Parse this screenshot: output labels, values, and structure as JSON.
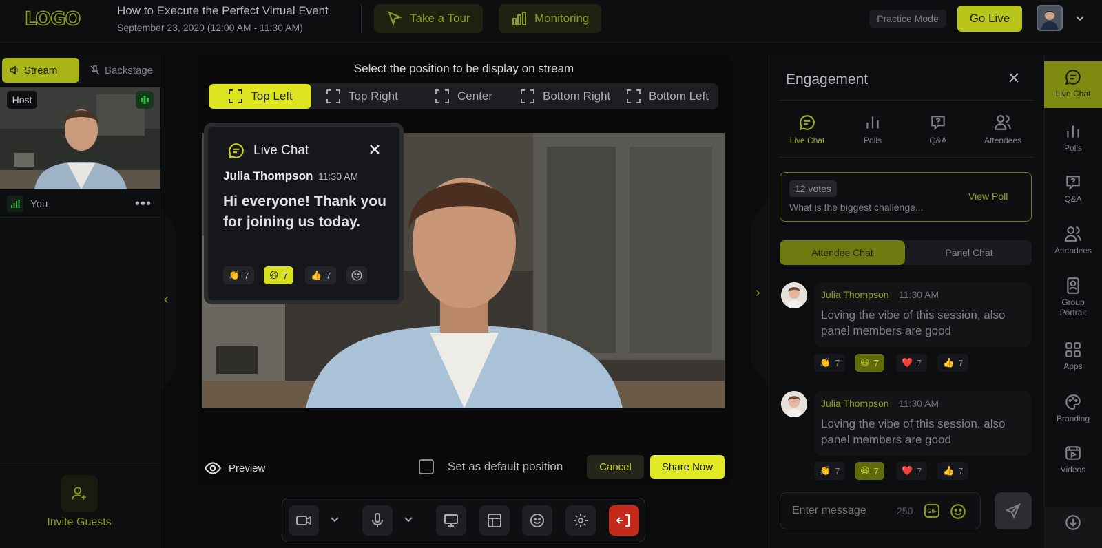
{
  "header": {
    "logo": "LOGO",
    "event_title": "How to Execute the Perfect Virtual Event",
    "event_date": "September 23, 2020 (12:00 AM - 11:30 AM)",
    "take_tour": "Take a Tour",
    "monitoring": "Monitoring",
    "practice_mode": "Practice Mode",
    "go_live": "Go Live"
  },
  "left": {
    "stream": "Stream",
    "backstage": "Backstage",
    "host_badge": "Host",
    "you_label": "You",
    "more": "•••",
    "invite_guests": "Invite Guests"
  },
  "modal": {
    "title": "Select the position to be display on stream",
    "positions": [
      "Top Left",
      "Top Right",
      "Center",
      "Bottom Right",
      "Bottom Left"
    ],
    "active_position": "Top Left",
    "preview": "Preview",
    "default_label": "Set as default position",
    "cancel": "Cancel",
    "share": "Share Now"
  },
  "overlay": {
    "title": "Live Chat",
    "name": "Julia Thompson",
    "time": "11:30 AM",
    "message": "Hi everyone! Thank you for joining us today.",
    "reactions": [
      {
        "emoji": "👏",
        "count": "7"
      },
      {
        "emoji": "😆",
        "count": "7"
      },
      {
        "emoji": "👍",
        "count": "7"
      }
    ]
  },
  "engagement": {
    "title": "Engagement",
    "tabs": [
      "Live Chat",
      "Polls",
      "Q&A",
      "Attendees"
    ],
    "poll_votes": "12 votes",
    "poll_question": "What is the biggest challenge...",
    "view_poll": "View Poll",
    "attendee_chat": "Attendee Chat",
    "panel_chat": "Panel Chat",
    "messages": [
      {
        "name": "Julia Thompson",
        "time": "11:30 AM",
        "text": "Loving the vibe of this session, also panel members are good",
        "reactions": [
          {
            "emoji": "👏",
            "count": "7"
          },
          {
            "emoji": "😆",
            "count": "7"
          },
          {
            "emoji": "❤️",
            "count": "7"
          },
          {
            "emoji": "👍",
            "count": "7"
          }
        ]
      },
      {
        "name": "Julia Thompson",
        "time": "11:30 AM",
        "text": "Loving the vibe of this session, also panel members are good",
        "reactions": [
          {
            "emoji": "👏",
            "count": "7"
          },
          {
            "emoji": "😆",
            "count": "7"
          },
          {
            "emoji": "❤️",
            "count": "7"
          },
          {
            "emoji": "👍",
            "count": "7"
          }
        ]
      }
    ],
    "input_placeholder": "Enter message",
    "char_count": "250",
    "gif": "GIF"
  },
  "rail": {
    "items": [
      "Live Chat",
      "Polls",
      "Q&A",
      "Attendees",
      "Group Portrait",
      "Apps",
      "Branding",
      "Videos"
    ]
  },
  "colors": {
    "accent": "#dce51f",
    "accent_dark": "#8f9d1c",
    "danger": "#c32a1a",
    "background": "#0b0c0e"
  }
}
